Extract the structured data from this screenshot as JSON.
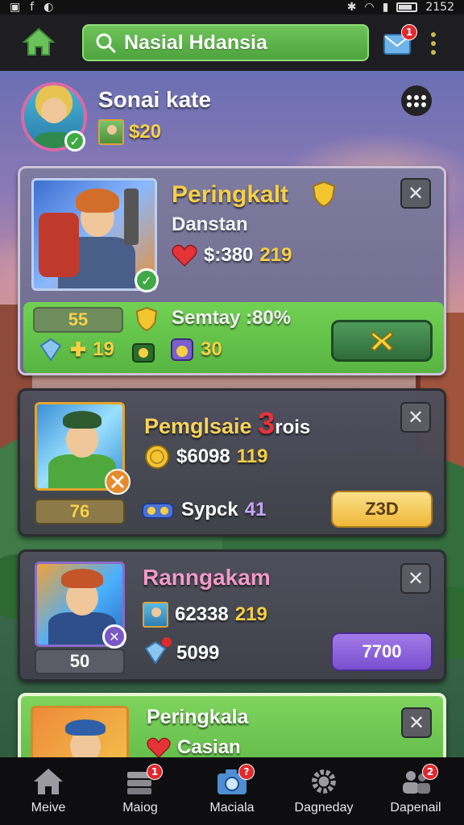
{
  "status_bar": {
    "time": "2152"
  },
  "top_bar": {
    "search_text": "Nasial Hdansia",
    "mail_badge": "1"
  },
  "profile": {
    "name": "Sonai kate",
    "coins": "$20"
  },
  "cards": [
    {
      "title": "Peringkalt",
      "subtitle": "Danstan",
      "price": "$:380",
      "price_extra": "219",
      "level": "55",
      "bonus_label": "Semtay :80%",
      "gem_value": "19",
      "potion_value": "30",
      "accent": "#6fd04f"
    },
    {
      "title": "Pemglsaie",
      "title_number": "3",
      "title_suffix": "rois",
      "price": "$6098",
      "price_extra": "119",
      "level": "76",
      "item_label": "Sypck",
      "item_value": "41",
      "button_label": "Z3D"
    },
    {
      "title": "Ranngakam",
      "price": "62338",
      "price_extra": "219",
      "level": "50",
      "gem_value": "5099",
      "button_label": "7700"
    },
    {
      "title": "Peringkala",
      "subtitle": "Casian"
    }
  ],
  "bottom_nav": [
    {
      "label": "Meive",
      "icon": "home-icon",
      "badge": ""
    },
    {
      "label": "Maiog",
      "icon": "stack-icon",
      "badge": "1"
    },
    {
      "label": "Maciala",
      "icon": "camera-icon",
      "badge": "?"
    },
    {
      "label": "Dagneday",
      "icon": "gear-icon",
      "badge": ""
    },
    {
      "label": "Dapenail",
      "icon": "people-icon",
      "badge": "2"
    }
  ],
  "colors": {
    "brand_green": "#5fb848",
    "gold": "#f6cf45",
    "purple_button": "#8a5bd6",
    "yellow_button": "#f7c84a"
  }
}
